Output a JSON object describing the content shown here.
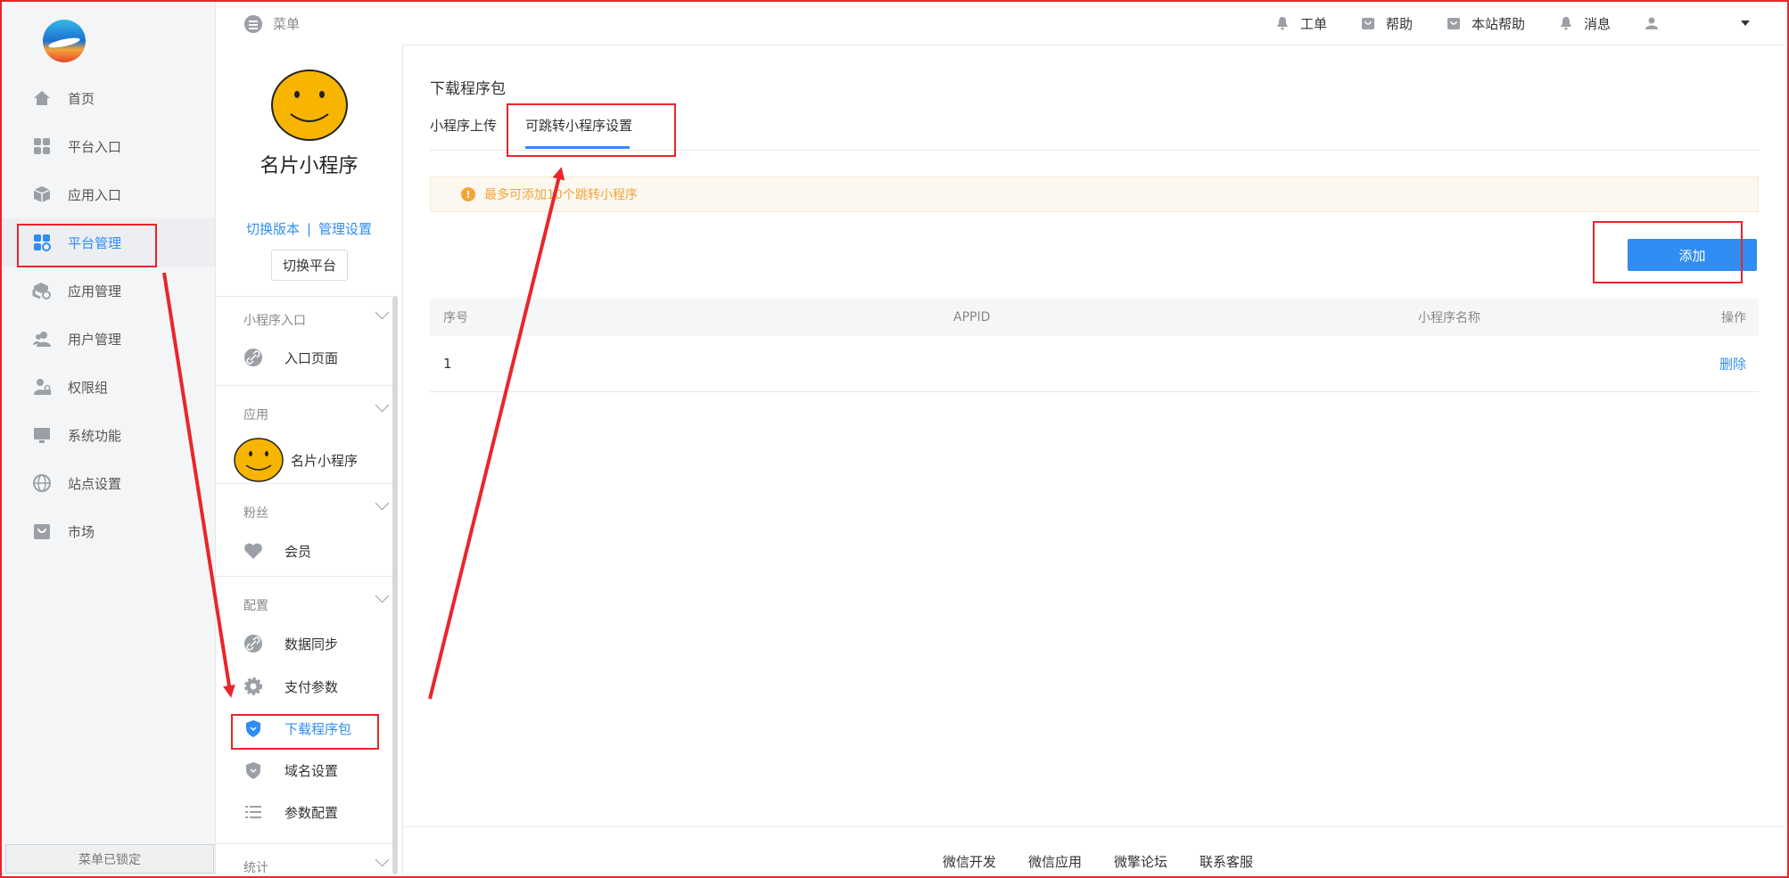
{
  "sidebar": {
    "items": [
      {
        "label": "首页",
        "icon": "home-icon"
      },
      {
        "label": "平台入口",
        "icon": "grid-icon"
      },
      {
        "label": "应用入口",
        "icon": "cube-icon"
      },
      {
        "label": "平台管理",
        "icon": "grid-gear-icon",
        "active": true
      },
      {
        "label": "应用管理",
        "icon": "cube-gear-icon"
      },
      {
        "label": "用户管理",
        "icon": "users-icon"
      },
      {
        "label": "权限组",
        "icon": "user-lock-icon"
      },
      {
        "label": "系统功能",
        "icon": "monitor-icon"
      },
      {
        "label": "站点设置",
        "icon": "globe-icon"
      },
      {
        "label": "市场",
        "icon": "bag-icon"
      }
    ],
    "lock_label": "菜单已锁定"
  },
  "topbar": {
    "menu_label": "菜单",
    "links": [
      {
        "label": "工单",
        "icon": "bell-icon"
      },
      {
        "label": "帮助",
        "icon": "bag-icon"
      },
      {
        "label": "本站帮助",
        "icon": "bag-icon"
      },
      {
        "label": "消息",
        "icon": "bell-icon"
      }
    ]
  },
  "panel": {
    "app_name": "名片小程序",
    "switch_version": "切换版本",
    "separator": "|",
    "manage_settings": "管理设置",
    "switch_platform": "切换平台",
    "sections": [
      {
        "title": "小程序入口",
        "items": [
          {
            "label": "入口页面",
            "icon": "link-icon"
          }
        ]
      },
      {
        "title": "应用",
        "items": [
          {
            "label": "名片小程序",
            "icon": "smiley-icon"
          }
        ]
      },
      {
        "title": "粉丝",
        "items": [
          {
            "label": "会员",
            "icon": "heart-icon"
          }
        ]
      },
      {
        "title": "配置",
        "items": [
          {
            "label": "数据同步",
            "icon": "link-icon"
          },
          {
            "label": "支付参数",
            "icon": "gear-icon"
          },
          {
            "label": "下载程序包",
            "icon": "shield-icon",
            "active": true
          },
          {
            "label": "域名设置",
            "icon": "shield-icon"
          },
          {
            "label": "参数配置",
            "icon": "list-icon"
          }
        ]
      },
      {
        "title": "统计",
        "items": []
      }
    ]
  },
  "main": {
    "heading": "下载程序包",
    "tabs": [
      {
        "label": "小程序上传"
      },
      {
        "label": "可跳转小程序设置",
        "active": true
      }
    ],
    "notice": "最多可添加10个跳转小程序",
    "add_button": "添加",
    "table": {
      "columns": [
        "序号",
        "APPID",
        "小程序名称",
        "操作"
      ],
      "rows": [
        {
          "index": "1",
          "appid": "",
          "name": "",
          "action": "删除"
        }
      ]
    },
    "footer_links": [
      "微信开发",
      "微信应用",
      "微擎论坛",
      "联系客服"
    ]
  },
  "colors": {
    "accent": "#2f8df3",
    "annotation": "#e8262b",
    "notice_text": "#f0a33a"
  }
}
